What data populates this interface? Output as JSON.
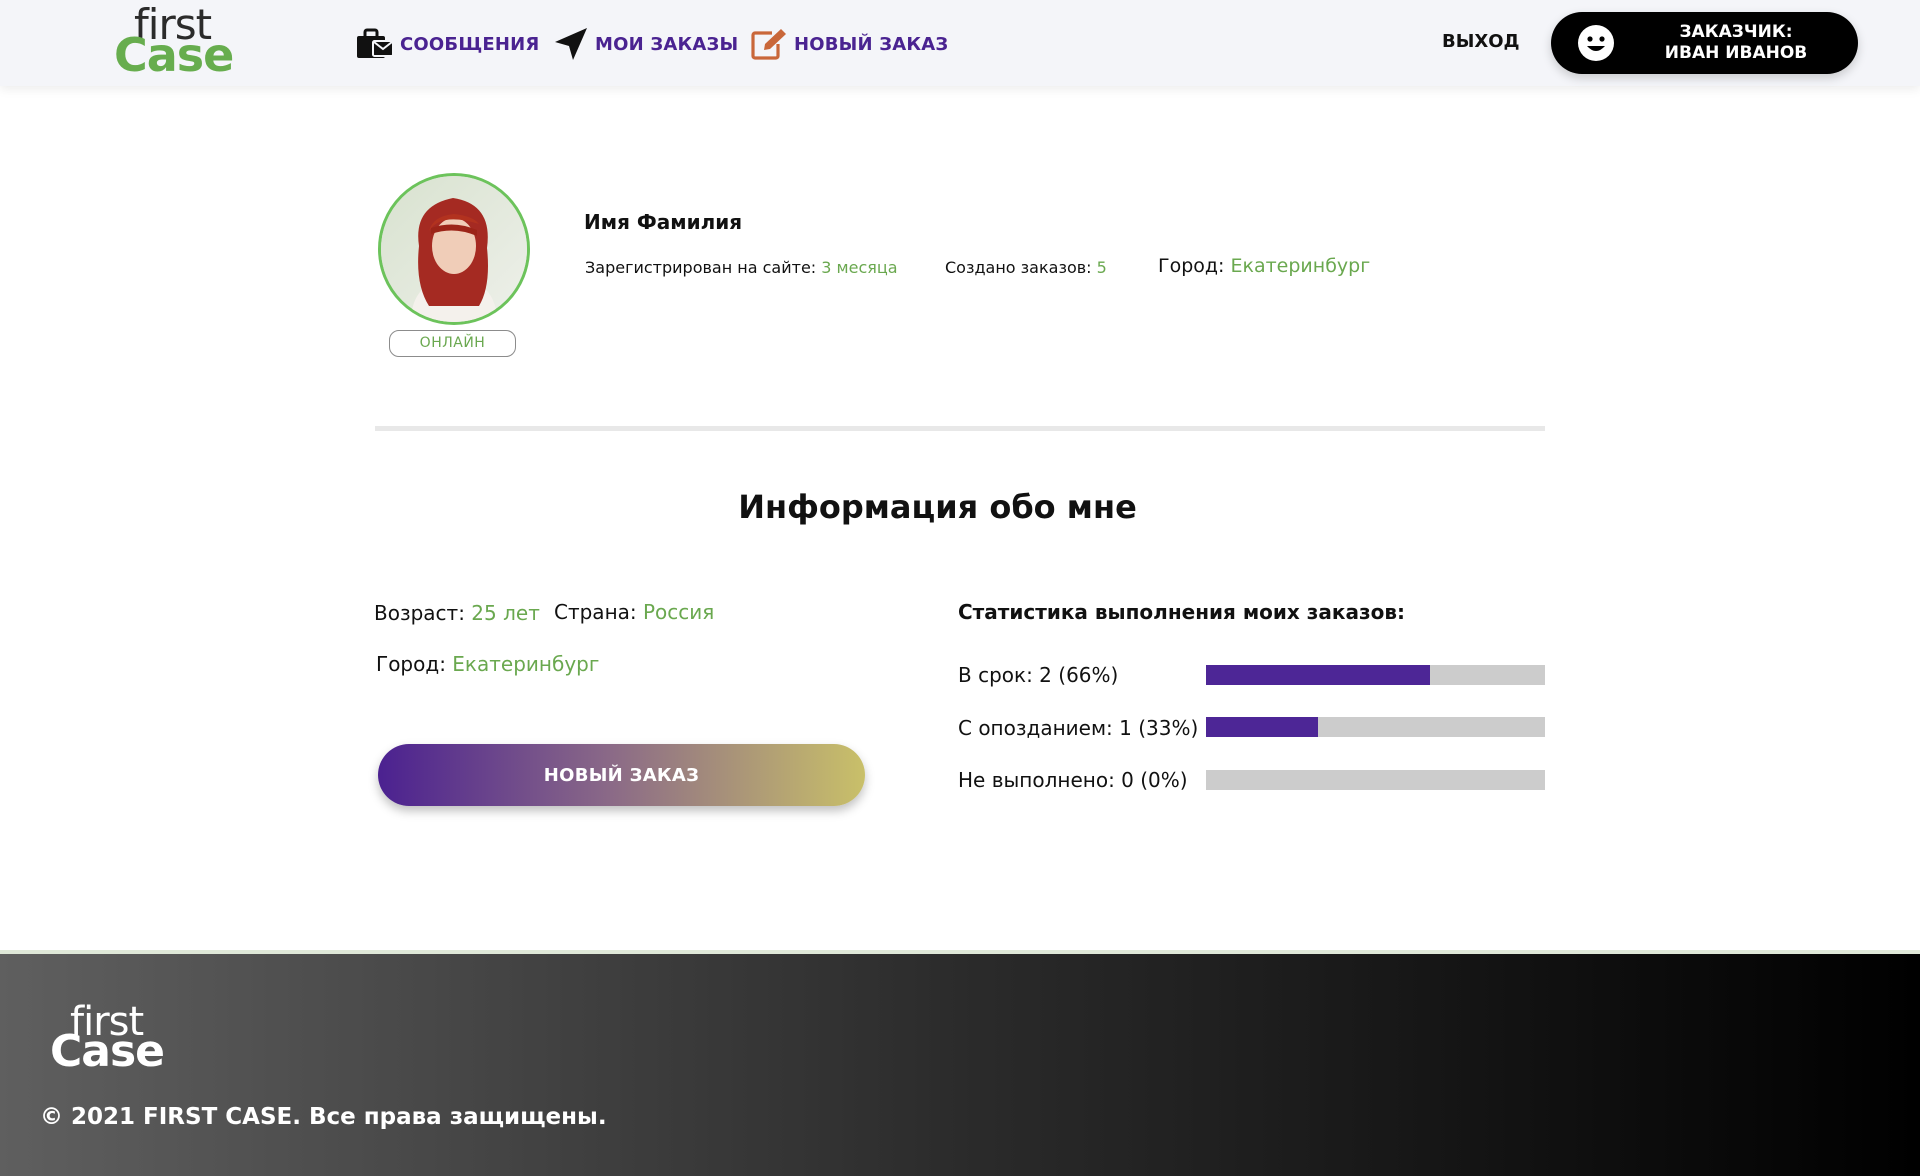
{
  "brand": {
    "logo_top": "first",
    "logo_bottom": "Case"
  },
  "header": {
    "nav": [
      {
        "label": "СООБЩЕНИЯ",
        "icon": "briefcase-mail-icon"
      },
      {
        "label": "МОИ ЗАКАЗЫ",
        "icon": "location-arrow-icon"
      },
      {
        "label": "НОВЫЙ ЗАКАЗ",
        "icon": "edit-icon"
      }
    ],
    "logout_label": "ВЫХОД",
    "user": {
      "role": "ЗАКАЗЧИК:",
      "name": "ИВАН ИВАНОВ",
      "icon": "smiley-icon"
    }
  },
  "profile": {
    "status": "ОНЛАЙН",
    "name": "Имя Фамилия",
    "registered_label": "Зарегистрирован на сайте:",
    "registered_value": "3 месяца",
    "orders_label": "Создано заказов:",
    "orders_value": "5",
    "city_label": "Город:",
    "city_value": "Екатеринбург"
  },
  "about": {
    "title": "Информация обо мне",
    "age_label": "Возраст:",
    "age_value": "25 лет",
    "country_label": "Страна:",
    "country_value": "Россия",
    "city_label": "Город:",
    "city_value": "Екатеринбург",
    "new_order_button": "НОВЫЙ ЗАКАЗ"
  },
  "stats": {
    "title": "Статистика выполнения моих заказов:",
    "rows": [
      {
        "label": "В срок: 2 (66%)",
        "percent": 66
      },
      {
        "label": "С опозданием: 1 (33%)",
        "percent": 33
      },
      {
        "label": "Не выполнено: 0 (0%)",
        "percent": 0
      }
    ]
  },
  "footer": {
    "logo_top": "first",
    "logo_bottom": "Case",
    "copyright": "© 2021 FIRST CASE. Все права защищены."
  },
  "colors": {
    "accent_green": "#6aa84f",
    "accent_purple": "#4b2190",
    "nav_text": "#4a2391"
  }
}
